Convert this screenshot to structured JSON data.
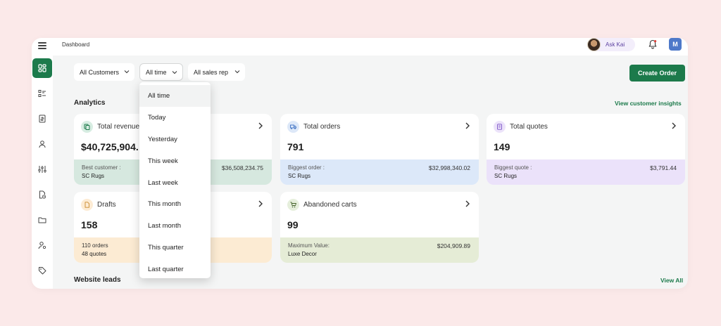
{
  "topbar": {
    "breadcrumb": "Dashboard",
    "ask_label": "Ask Kai",
    "user_initial": "M"
  },
  "filters": {
    "customers": "All Customers",
    "time": "All time",
    "sales_rep": "All sales rep"
  },
  "create_order_label": "Create Order",
  "analytics": {
    "title": "Analytics",
    "insights_link": "View customer insights"
  },
  "cards": {
    "revenue": {
      "title": "Total revenue",
      "value": "$40,725,904.",
      "label": "Best customer :",
      "sub": "SC Rugs",
      "right": "$36,508,234.75",
      "band_color": "#d6e8df",
      "icon_bg": "#d7ede2"
    },
    "orders": {
      "title": "Total orders",
      "value": "791",
      "label": "Biggest order :",
      "sub": "SC Rugs",
      "right": "$32,998,340.02",
      "band_color": "#dce8f9",
      "icon_bg": "#dde8f8"
    },
    "quotes": {
      "title": "Total quotes",
      "value": "149",
      "label": "Biggest quote :",
      "sub": "SC Rugs",
      "right": "$3,791.44",
      "band_color": "#ebe2fa",
      "icon_bg": "#ece3fa"
    },
    "drafts": {
      "title": "Drafts",
      "value": "158",
      "label": "110 orders",
      "sub": "48 quotes",
      "band_color": "#fcebd3",
      "icon_bg": "#fdebd3"
    },
    "carts": {
      "title": "Abandoned carts",
      "value": "99",
      "label": "Maximum Value:",
      "sub": "Luxe Decor",
      "right": "$204,909.89",
      "band_color": "#e5ecd6",
      "icon_bg": "#e6efdc"
    }
  },
  "website_leads": {
    "title": "Website leads",
    "view_all": "View All"
  },
  "time_dropdown": {
    "options": [
      "All time",
      "Today",
      "Yesterday",
      "This week",
      "Last week",
      "This month",
      "Last month",
      "This quarter",
      "Last quarter"
    ],
    "selected": "All time"
  },
  "colors": {
    "accent": "#1c7a4b",
    "background": "#fbe9e9"
  }
}
